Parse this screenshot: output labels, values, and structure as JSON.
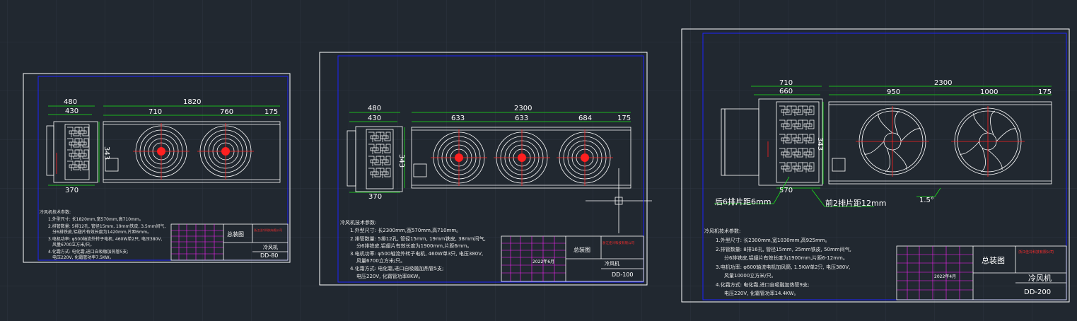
{
  "colors": {
    "background": "#212830",
    "grid": "#2d3540",
    "sheet": "#ffffff",
    "frame": "#1c22ff",
    "dimension": "#19e619",
    "centerline": "#ff2020",
    "table": "#ff20ff",
    "text": "#ffffff"
  },
  "drawings": [
    {
      "dims": {
        "top_a": "480",
        "top_b": "430",
        "total": "1820",
        "fan1": "710",
        "fan2": "760",
        "end": "175",
        "height": "343",
        "bottom": "370"
      },
      "notes": {
        "heading": "冷风机技术参数:",
        "lines": [
          "1.外型尺寸: 长1820mm,宽570mm,高710mm。",
          "2.排管数量: 5排12孔, 管径15mm, 19mm铁皮, 3.5mm间气,",
          "分6排铁皮,铝翅片有效长度为1420mm,片距6mm。",
          "3.电机功率: φ500轴流外转子电机, 460W单2只, 电压380V,",
          "风量6700立方米/只。",
          "4.化霜方式: 电化霜,进口自吸融加热管5支;",
          "电压220V, 化霜管功率7.5KW。"
        ]
      },
      "table": {
        "title": "总装图",
        "company": "浙江佳冷科技有限公司",
        "product": "冷风机",
        "model": "DD-80",
        "date": ""
      }
    },
    {
      "dims": {
        "top_a": "480",
        "top_b": "430",
        "total": "2300",
        "fan1": "633",
        "fan2": "633",
        "fan3": "684",
        "end": "175",
        "height": "343",
        "bottom": "370"
      },
      "notes": {
        "heading": "冷风机技术参数:",
        "lines": [
          "1.外型尺寸: 长2300mm,宽570mm,高710mm。",
          "2.排管数量: 5排12孔, 管径15mm, 19mm铁皮, 38mm间气,",
          "分6排铁皮,铝翅片有效长度为1900mm,片距6mm。",
          "3.电机功率: φ500轴流外转子电机, 460W单3只, 电压380V,",
          "风量6700立方米/只。",
          "4.化霜方式: 电化霜,进口自吸融加热管5支;",
          "电压220V, 化霜管功率8KW。"
        ]
      },
      "table": {
        "title": "总装图",
        "company": "浙江佳冷科技有限公司",
        "product": "冷风机",
        "model": "DD-100",
        "date": "2022年6月"
      }
    },
    {
      "dims": {
        "top_a": "710",
        "top_b": "660",
        "total": "2300",
        "fan1": "950",
        "fan2": "1000",
        "end": "175",
        "height": "343",
        "bottom": "570"
      },
      "callouts": {
        "rear": "后6排片距6mm",
        "front": "前2排片距12mm",
        "angle": "1.5°"
      },
      "notes": {
        "heading": "冷风机技术参数:",
        "lines": [
          "1.外型尺寸: 长2300mm,宽1030mm,高925mm。",
          "2.排管数量: 8排16孔, 管径15mm, 25mm铁皮, 50mm间气,",
          "分6排铁皮,铝翅片有效长度为1900mm,片距6-12mm。",
          "3.电机功率: φ600轴流电机加风筒, 1.5KW单2只, 电压380V,",
          "风量10000立方米/只。",
          "4.化霜方式: 电化霜,进口自吸融加热管9支;",
          "电压220V, 化霜管功率14.4KW。"
        ]
      },
      "table": {
        "title": "总装图",
        "company": "浙江佳冷科技有限公司",
        "product": "冷风机",
        "model": "DD-200",
        "date": "2022年4月"
      }
    }
  ]
}
